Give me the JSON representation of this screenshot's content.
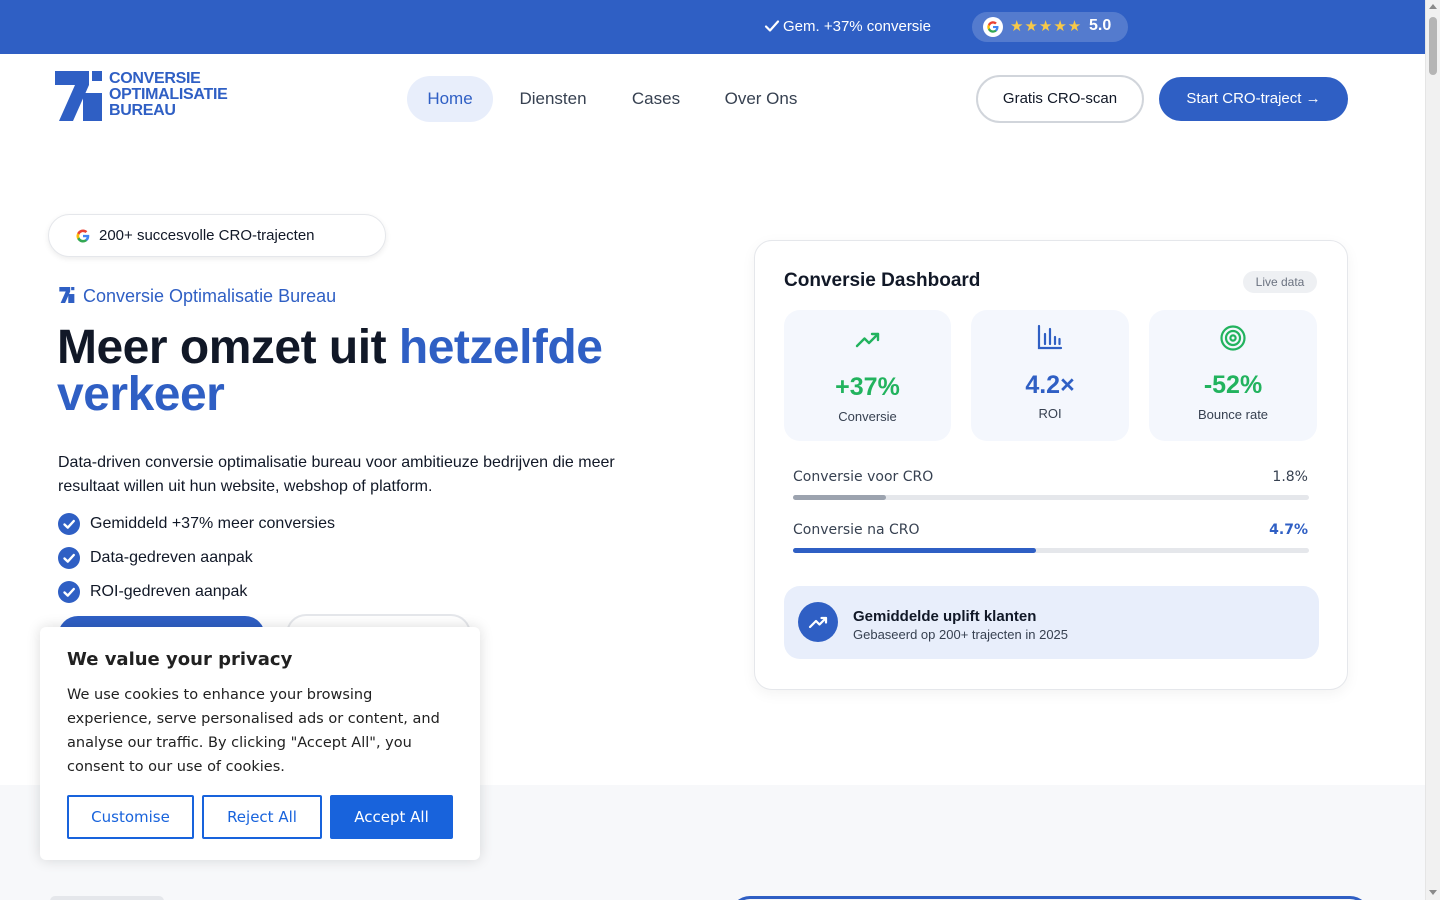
{
  "topbar": {
    "conversion_text": "Gem. +37% conversie",
    "stars": "★★★★★",
    "rating": "5.0",
    "icons": [
      "check-icon",
      "google-icon",
      "star-icon"
    ]
  },
  "logo": {
    "line1": "CONVERSIE",
    "line2": "OPTIMALISATIE",
    "line3": "BUREAU"
  },
  "nav": {
    "items": [
      {
        "label": "Home",
        "active": true
      },
      {
        "label": "Diensten"
      },
      {
        "label": "Cases"
      },
      {
        "label": "Over Ons"
      }
    ],
    "scan_label": "Gratis CRO-scan",
    "start_label": "Start CRO-traject →"
  },
  "hero": {
    "badge_text": "200+ succesvolle CRO-trajecten",
    "brand_text": "Conversie Optimalisatie Bureau",
    "title_part1": "Meer omzet uit ",
    "title_accent": "hetzelfde verkeer",
    "description": "Data-driven conversie optimalisatie bureau voor ambitieuze bedrijven die meer resultaat willen uit hun website, webshop of platform.",
    "checks": [
      "Gemiddeld +37% meer conversies",
      "Data-gedreven aanpak",
      "ROI-gedreven aanpak"
    ]
  },
  "dashboard": {
    "title": "Conversie Dashboard",
    "live_badge": "Live data",
    "stats": [
      {
        "value": "+37%",
        "label": "Conversie",
        "icon": "trending-up-icon"
      },
      {
        "value": "4.2×",
        "label": "ROI",
        "icon": "bar-chart-icon"
      },
      {
        "value": "-52%",
        "label": "Bounce rate",
        "icon": "target-icon"
      }
    ],
    "bars": [
      {
        "label": "Conversie voor CRO",
        "value_text": "1.8%",
        "fraction": 0.18,
        "color": "#9ca3af"
      },
      {
        "label": "Conversie na CRO",
        "value_text": "4.7%",
        "fraction": 0.47,
        "color": "#2f5fc4"
      }
    ],
    "uplift_title": "Gemiddelde uplift klanten",
    "uplift_sub": "Gebaseerd op 200+ trajecten in 2025"
  },
  "cookie": {
    "title": "We value your privacy",
    "text": "We use cookies to enhance your browsing experience, serve personalised ads or content, and analyse our traffic. By clicking \"Accept All\", you consent to our use of cookies.",
    "customise": "Customise",
    "reject": "Reject All",
    "accept": "Accept All"
  },
  "colors": {
    "brand": "#2f5fc4",
    "green": "#22b35e",
    "cookie_blue": "#1863dc"
  }
}
